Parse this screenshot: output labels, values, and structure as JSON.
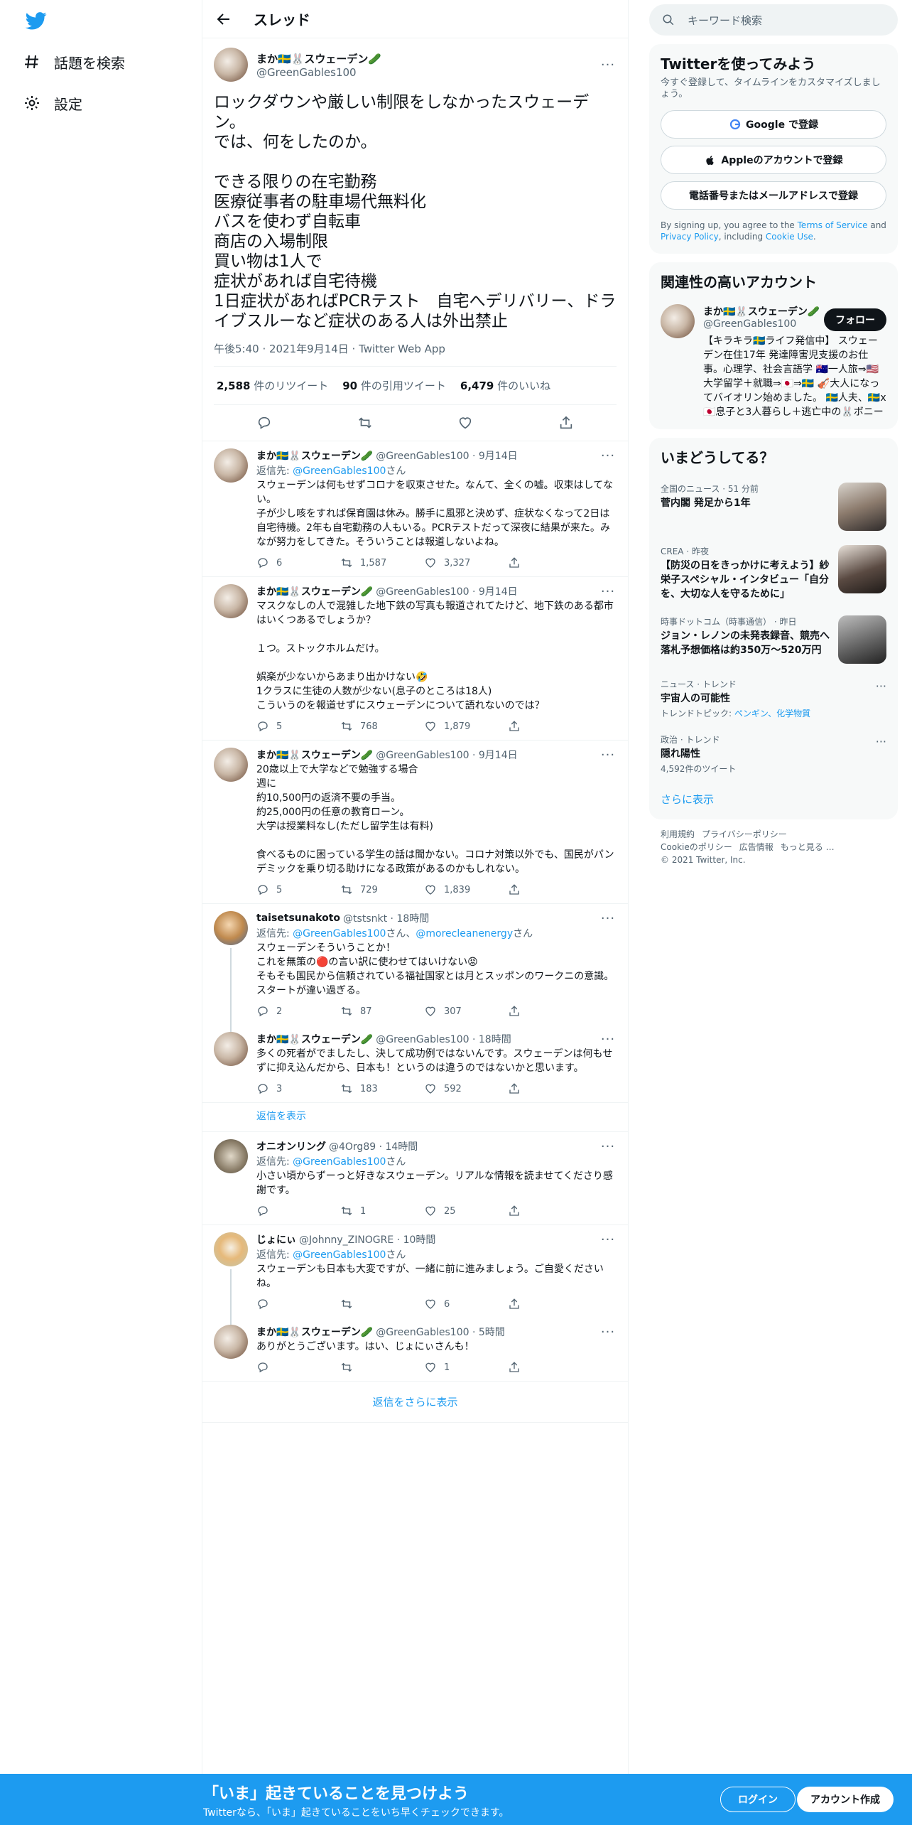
{
  "nav": {
    "explore": "話題を検索",
    "settings": "設定"
  },
  "header": {
    "title": "スレッド"
  },
  "main": {
    "name": "まか🇸🇪🐰スウェーデン🥒",
    "handle": "@GreenGables100",
    "body": "ロックダウンや厳しい制限をしなかったスウェーデン。\nでは、何をしたのか。\n\nできる限りの在宅勤務\n医療従事者の駐車場代無料化\nバスを使わず自転車\n商店の入場制限\n買い物は1人で\n症状があれば自宅待機\n1日症状があればPCRテスト　自宅へデリバリー、ドライブスルーなど症状のある人は外出禁止",
    "meta": "午後5:40 · 2021年9月14日 · Twitter Web App",
    "retweets": "2,588",
    "retweets_label": "件のリツイート",
    "quotes": "90",
    "quotes_label": "件の引用ツイート",
    "likes": "6,479",
    "likes_label": "件のいいね"
  },
  "replies": [
    {
      "name": "まか🇸🇪🐰スウェーデン🥒",
      "handle": "@GreenGables100 · 9月14日",
      "replyto_prefix": "返信先: ",
      "replyto": "@GreenGables100",
      "replyto_suffix": "さん",
      "text": "スウェーデンは何もせずコロナを収束させた。なんて、全くの嘘。収束はしてない。\n子が少し咳をすれば保育園は休み。勝手に風邪と決めず、症状なくなって2日は自宅待機。2年も自宅勤務の人もいる。PCRテストだって深夜に結果が来た。みなが努力をしてきた。そういうことは報道しないよね。",
      "c": "6",
      "r": "1,587",
      "l": "3,327"
    },
    {
      "name": "まか🇸🇪🐰スウェーデン🥒",
      "handle": "@GreenGables100 · 9月14日",
      "text": "マスクなしの人で混雑した地下鉄の写真も報道されてたけど、地下鉄のある都市はいくつあるでしょうか？\n\n１つ。ストックホルムだけ。\n\n娯楽が少ないからあまり出かけない🤣\n1クラスに生徒の人数が少ない(息子のところは18人)\nこういうのを報道せずにスウェーデンについて語れないのでは？",
      "c": "5",
      "r": "768",
      "l": "1,879"
    },
    {
      "name": "まか🇸🇪🐰スウェーデン🥒",
      "handle": "@GreenGables100 · 9月14日",
      "text": "20歳以上で大学などで勉強する場合\n週に\n約10,500円の返済不要の手当。\n約25,000円の任意の教育ローン。\n大学は授業料なし(ただし留学生は有料)\n\n食べるものに困っている学生の話は聞かない。コロナ対策以外でも、国民がパンデミックを乗り切る助けになる政策があるのかもしれない。",
      "c": "5",
      "r": "729",
      "l": "1,839"
    },
    {
      "name": "taisetsunakoto",
      "handle": "@tstsnkt · 18時間",
      "replyto_prefix": "返信先: ",
      "replyto": "@GreenGables100",
      "replyto_mid": "さん、",
      "replyto2": "@morecleanenergy",
      "replyto_suffix": "さん",
      "text": "スウェーデンそういうことか！\nこれを無策の🔴の言い訳に使わせてはいけない😡\nそもそも国民から信頼されている福祉国家とは月とスッポンのワークニの意識。\nスタートが違い過ぎる。",
      "c": "2",
      "r": "87",
      "l": "307"
    },
    {
      "name": "まか🇸🇪🐰スウェーデン🥒",
      "handle": "@GreenGables100 · 18時間",
      "text": "多くの死者がでましたし、決して成功例ではないんです。スウェーデンは何もせずに抑え込んだから、日本も！というのは違うのではないかと思います。",
      "c": "3",
      "r": "183",
      "l": "592"
    },
    {
      "name": "オニオンリング",
      "handle": "@4Org89 · 14時間",
      "replyto_prefix": "返信先: ",
      "replyto": "@GreenGables100",
      "replyto_suffix": "さん",
      "text": "小さい頃からずーっと好きなスウェーデン。リアルな情報を読ませてくださり感謝です。",
      "c": "",
      "r": "1",
      "l": "25"
    },
    {
      "name": "じょにぃ",
      "handle": "@Johnny_ZINOGRE · 10時間",
      "replyto_prefix": "返信先: ",
      "replyto": "@GreenGables100",
      "replyto_suffix": "さん",
      "text": "スウェーデンも日本も大変ですが、一緒に前に進みましょう。ご自愛くださいね。",
      "c": "",
      "r": "",
      "l": "6"
    },
    {
      "name": "まか🇸🇪🐰スウェーデン🥒",
      "handle": "@GreenGables100 · 5時間",
      "text": "ありがとうございます。はい、じょにぃさんも！",
      "c": "",
      "r": "",
      "l": "1"
    }
  ],
  "show_replies": "返信を表示",
  "more_replies": "返信をさらに表示",
  "right": {
    "search_placeholder": "キーワード検索",
    "signup_title": "Twitterを使ってみよう",
    "signup_sub": "今すぐ登録して、タイムラインをカスタマイズしましょう。",
    "google": "Google で登録",
    "apple": "Appleのアカウントで登録",
    "phone": "電話番号またはメールアドレスで登録",
    "terms_a": "By signing up, you agree to the ",
    "terms_tos": "Terms of Service",
    "terms_b": " and ",
    "terms_privacy": "Privacy Policy",
    "terms_c": ", including ",
    "terms_cookie": "Cookie Use",
    "terms_d": ".",
    "related_title": "関連性の高いアカウント",
    "acct_name": "まか🇸🇪🐰スウェーデン🥒",
    "acct_handle": "@GreenGables100",
    "follow": "フォロー",
    "acct_bio": "【キラキラ🇸🇪ライフ発信中】 スウェーデン在住17年 発達障害児支援のお仕事。心理学、社会言語学 🇦🇺一人旅⇒🇺🇸大学留学＋就職⇒🇯🇵⇒🇸🇪 🎻大人になってバイオリン始めました。 🇸🇪人夫、🇸🇪x🇯🇵息子と3人暮らし＋逃亡中の🐰ボニー",
    "trends_title": "いまどうしてる？",
    "trends": [
      {
        "meta": "全国のニュース · 51 分前",
        "title": "菅内閣 発足から1年",
        "sub": ""
      },
      {
        "meta": "CREA · 昨夜",
        "title": "【防災の日をきっかけに考えよう】紗栄子スペシャル・インタビュー「自分を、大切な人を守るために」",
        "sub": ""
      },
      {
        "meta": "時事ドットコム（時事通信） · 昨日",
        "title": "ジョン・レノンの未発表録音、競売へ　落札予想価格は約350万～520万円",
        "sub": ""
      },
      {
        "meta": "ニュース · トレンド",
        "title": "宇宙人の可能性",
        "sub_prefix": "トレンドトピック: ",
        "sub_links": "ペンギン、化学物質"
      },
      {
        "meta": "政治 · トレンド",
        "title": "隠れ陽性",
        "sub": "4,592件のツイート"
      }
    ],
    "show_more": "さらに表示",
    "footer": [
      "利用規約",
      "プライバシーポリシー",
      "Cookieのポリシー",
      "広告情報",
      "もっと見る …",
      "© 2021 Twitter, Inc."
    ]
  },
  "banner": {
    "title": "「いま」起きていることを見つけよう",
    "sub": "Twitterなら、「いま」起きていることをいち早くチェックできます。",
    "login": "ログイン",
    "signup": "アカウント作成"
  },
  "colors": {
    "accent": "#1d9bf0",
    "text": "#0f1419",
    "muted": "#536471"
  }
}
